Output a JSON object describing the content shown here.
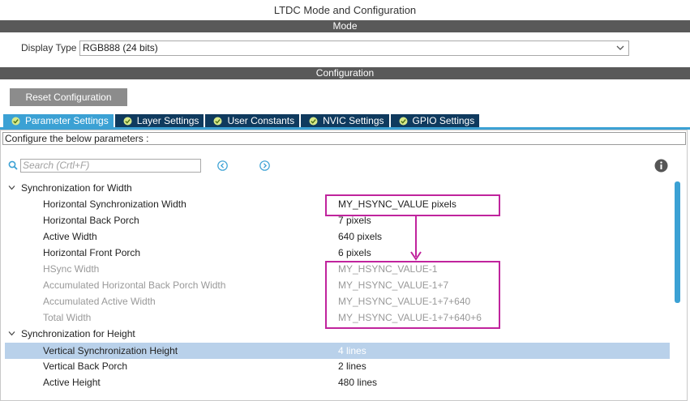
{
  "window": {
    "title": "LTDC Mode and Configuration"
  },
  "sections": {
    "mode": "Mode",
    "configuration": "Configuration"
  },
  "mode": {
    "display_type_label": "Display Type",
    "display_type_value": "RGB888 (24 bits)"
  },
  "toolbar": {
    "reset_label": "Reset Configuration"
  },
  "tabs": [
    {
      "label": "Parameter Settings",
      "active": true
    },
    {
      "label": "Layer Settings",
      "active": false
    },
    {
      "label": "User Constants",
      "active": false
    },
    {
      "label": "NVIC Settings",
      "active": false
    },
    {
      "label": "GPIO Settings",
      "active": false
    }
  ],
  "configure_text": "Configure the below parameters :",
  "search": {
    "placeholder": "Search (Crtl+F)"
  },
  "icons": {
    "search": "search-icon",
    "prev": "circle-left-icon",
    "next": "circle-right-icon",
    "info": "info-icon",
    "check": "check-circle-icon",
    "expand": "chevron-down-icon"
  },
  "colors": {
    "section_bar": "#595959",
    "tab_inactive": "#0f3a5e",
    "tab_active": "#3ba1d4",
    "highlight_box": "#c0249d",
    "selected_row": "#b9d1ea"
  },
  "params": {
    "width_group": {
      "label": "Synchronization for Width",
      "rows": [
        {
          "label": "Horizontal Synchronization Width",
          "value": "MY_HSYNC_VALUE pixels",
          "editable": true
        },
        {
          "label": "Horizontal Back Porch",
          "value": "7 pixels",
          "editable": true
        },
        {
          "label": "Active Width",
          "value": "640 pixels",
          "editable": true
        },
        {
          "label": "Horizontal Front Porch",
          "value": "6 pixels",
          "editable": true
        },
        {
          "label": "HSync Width",
          "value": "MY_HSYNC_VALUE-1",
          "editable": false
        },
        {
          "label": "Accumulated Horizontal Back Porch Width",
          "value": "MY_HSYNC_VALUE-1+7",
          "editable": false
        },
        {
          "label": "Accumulated Active Width",
          "value": "MY_HSYNC_VALUE-1+7+640",
          "editable": false
        },
        {
          "label": "Total Width",
          "value": "MY_HSYNC_VALUE-1+7+640+6",
          "editable": false
        }
      ]
    },
    "height_group": {
      "label": "Synchronization for Height",
      "rows": [
        {
          "label": "Vertical Synchronization Height",
          "value": "4 lines",
          "editable": true,
          "selected": true
        },
        {
          "label": "Vertical Back Porch",
          "value": "2 lines",
          "editable": true
        },
        {
          "label": "Active Height",
          "value": "480 lines",
          "editable": true
        }
      ]
    }
  }
}
